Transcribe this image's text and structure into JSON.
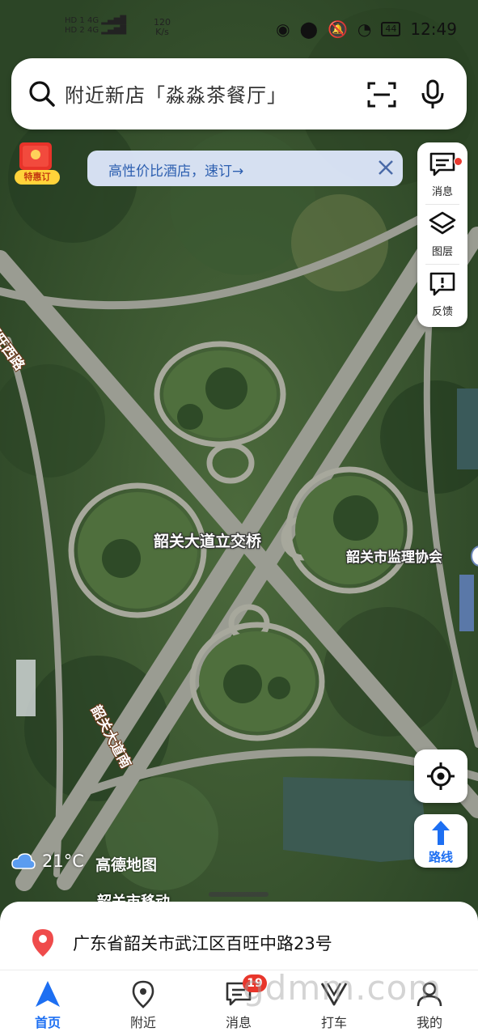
{
  "status_bar": {
    "sim1": "HD 1",
    "sim2": "HD 2",
    "net1": "4G",
    "net2": "4G",
    "speed_value": "120",
    "speed_unit": "K/s",
    "battery": "44",
    "time": "12:49"
  },
  "search": {
    "placeholder": "附近新店「淼淼茶餐厅」",
    "icons": [
      "search-icon",
      "scan-icon",
      "microphone-icon"
    ]
  },
  "promo": {
    "tag": "特惠订"
  },
  "banner": {
    "text": "高性价比酒店，速订→"
  },
  "side_panel": {
    "items": [
      {
        "label": "消息",
        "icon": "message-icon",
        "has_dot": true
      },
      {
        "label": "图层",
        "icon": "layers-icon"
      },
      {
        "label": "反馈",
        "icon": "feedback-icon"
      }
    ]
  },
  "map": {
    "labels": {
      "interchange": "韶关大道立交桥",
      "association": "韶关市监理协会",
      "road_west": "百旺西路",
      "road_south": "韶关大道南",
      "partial": "韶关市移动"
    }
  },
  "weather": {
    "temp": "21°C",
    "icon": "cloud-icon"
  },
  "brand": "高德地图",
  "route_button": {
    "label": "路线"
  },
  "sheet": {
    "address": "广东省韶关市武江区百旺中路23号"
  },
  "tabs": [
    {
      "label": "首页",
      "icon": "navigate-icon",
      "active": true
    },
    {
      "label": "附近",
      "icon": "location-pin-icon"
    },
    {
      "label": "消息",
      "icon": "chat-icon",
      "badge": "19"
    },
    {
      "label": "打车",
      "icon": "taxi-icon"
    },
    {
      "label": "我的",
      "icon": "user-icon"
    }
  ],
  "watermark": "gdmm.com",
  "colors": {
    "accent": "#1d6ff2",
    "badge": "#e8362b",
    "pin": "#ef4b4b"
  }
}
